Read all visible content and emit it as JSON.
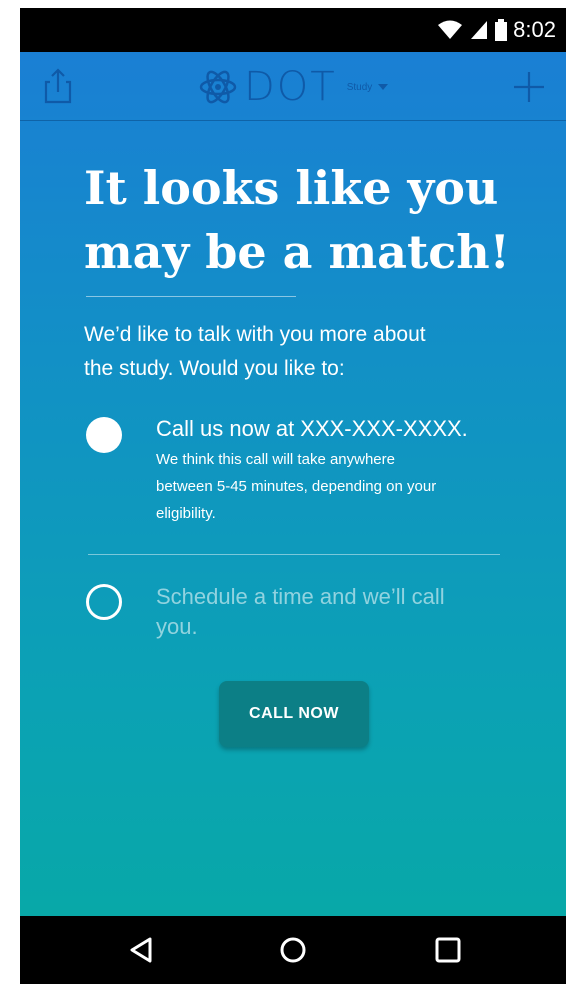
{
  "status_bar": {
    "time": "8:02",
    "icons": [
      "wifi-icon",
      "signal-icon",
      "battery-icon"
    ]
  },
  "app_bar": {
    "logo_text": "DOT",
    "study_selector": "Study",
    "icons": [
      "share-icon",
      "atom-logo-icon",
      "dropdown-caret-icon",
      "plus-icon"
    ]
  },
  "content": {
    "headline_line1": "It looks like you",
    "headline_line2": "may be a match!",
    "intro_line1": "We’d like to talk with you more about",
    "intro_line2": "the study. Would you like to:",
    "option_call": {
      "title": "Call us now at XXX-XXX-XXXX.",
      "desc_line1": "We think this call will take anywhere",
      "desc_line2": "between 5-45 minutes, depending on your",
      "desc_line3": "eligibility.",
      "selected": true
    },
    "option_schedule": {
      "title_line1": "Schedule a time and we’ll call",
      "title_line2": "you.",
      "selected": false
    },
    "call_button": "CALL NOW"
  },
  "nav_bar": {
    "icons": [
      "back-icon",
      "home-icon",
      "recents-icon"
    ]
  },
  "colors": {
    "gradient_top": "#1a7fd4",
    "gradient_bottom": "#08a8a8",
    "logo": "#0f5aa8",
    "button": "#0c7f86"
  }
}
